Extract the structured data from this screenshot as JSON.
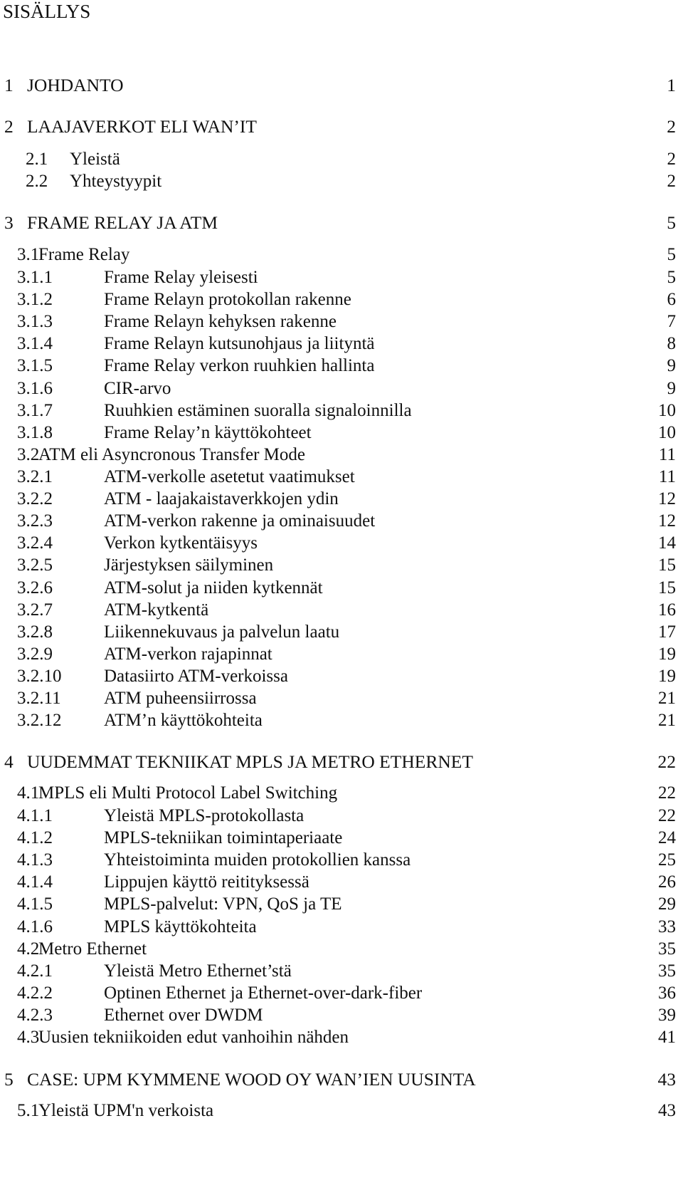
{
  "title": "SISÄLLYS",
  "entries": [
    {
      "num": "1",
      "text": "JOHDANTO",
      "page": "1",
      "level": 1
    },
    {
      "num": "2",
      "text": "LAAJAVERKOT ELI WAN’IT",
      "page": "2",
      "level": 1
    },
    {
      "num": "2.1",
      "text": "Yleistä",
      "page": "2",
      "level": 2
    },
    {
      "num": "2.2",
      "text": "Yhteystyypit",
      "page": "2",
      "level": 2
    },
    {
      "num": "3",
      "text": "FRAME RELAY JA ATM",
      "page": "5",
      "level": 1
    },
    {
      "num": "3.1",
      "text": "Frame Relay",
      "page": "5",
      "level": 2
    },
    {
      "num": "3.1.1",
      "text": "Frame Relay yleisesti",
      "page": "5",
      "level": 3
    },
    {
      "num": "3.1.2",
      "text": "Frame Relayn protokollan rakenne",
      "page": "6",
      "level": 3
    },
    {
      "num": "3.1.3",
      "text": "Frame Relayn kehyksen rakenne",
      "page": "7",
      "level": 3
    },
    {
      "num": "3.1.4",
      "text": "Frame Relayn kutsunohjaus ja liityntä",
      "page": "8",
      "level": 3
    },
    {
      "num": "3.1.5",
      "text": "Frame Relay verkon ruuhkien hallinta",
      "page": "9",
      "level": 3
    },
    {
      "num": "3.1.6",
      "text": "CIR-arvo",
      "page": "9",
      "level": 3
    },
    {
      "num": "3.1.7",
      "text": "Ruuhkien estäminen suoralla signaloinnilla",
      "page": "10",
      "level": 3
    },
    {
      "num": "3.1.8",
      "text": "Frame Relay’n käyttökohteet",
      "page": "10",
      "level": 3
    },
    {
      "num": "3.2",
      "text": "ATM eli Asyncronous Transfer Mode",
      "page": "11",
      "level": 2
    },
    {
      "num": "3.2.1",
      "text": "ATM-verkolle asetetut vaatimukset",
      "page": "11",
      "level": 3
    },
    {
      "num": "3.2.2",
      "text": "ATM - laajakaistaverkkojen ydin",
      "page": "12",
      "level": 3
    },
    {
      "num": "3.2.3",
      "text": "ATM-verkon rakenne ja ominaisuudet",
      "page": "12",
      "level": 3
    },
    {
      "num": "3.2.4",
      "text": "Verkon kytkentäisyys",
      "page": "14",
      "level": 3
    },
    {
      "num": "3.2.5",
      "text": "Järjestyksen säilyminen",
      "page": "15",
      "level": 3
    },
    {
      "num": "3.2.6",
      "text": "ATM-solut ja niiden kytkennät",
      "page": "15",
      "level": 3
    },
    {
      "num": "3.2.7",
      "text": "ATM-kytkentä",
      "page": "16",
      "level": 3
    },
    {
      "num": "3.2.8",
      "text": "Liikennekuvaus ja palvelun laatu",
      "page": "17",
      "level": 3
    },
    {
      "num": "3.2.9",
      "text": "ATM-verkon rajapinnat",
      "page": "19",
      "level": 3
    },
    {
      "num": "3.2.10",
      "text": "Datasiirto ATM-verkoissa",
      "page": "19",
      "level": 3
    },
    {
      "num": "3.2.11",
      "text": "ATM puheensiirrossa",
      "page": "21",
      "level": 3
    },
    {
      "num": "3.2.12",
      "text": "ATM’n käyttökohteita",
      "page": "21",
      "level": 3
    },
    {
      "num": "4",
      "text": "UUDEMMAT TEKNIIKAT MPLS JA METRO ETHERNET",
      "page": "22",
      "level": 1
    },
    {
      "num": "4.1",
      "text": "MPLS eli Multi Protocol Label Switching",
      "page": "22",
      "level": 2
    },
    {
      "num": "4.1.1",
      "text": "Yleistä MPLS-protokollasta",
      "page": "22",
      "level": 3
    },
    {
      "num": "4.1.2",
      "text": "MPLS-tekniikan toimintaperiaate",
      "page": "24",
      "level": 3
    },
    {
      "num": "4.1.3",
      "text": "Yhteistoiminta muiden protokollien kanssa",
      "page": "25",
      "level": 3
    },
    {
      "num": "4.1.4",
      "text": "Lippujen käyttö reitityksessä",
      "page": "26",
      "level": 3
    },
    {
      "num": "4.1.5",
      "text": "MPLS-palvelut: VPN, QoS ja TE",
      "page": "29",
      "level": 3
    },
    {
      "num": "4.1.6",
      "text": "MPLS käyttökohteita",
      "page": "33",
      "level": 3
    },
    {
      "num": "4.2",
      "text": "Metro Ethernet",
      "page": "35",
      "level": 2
    },
    {
      "num": "4.2.1",
      "text": "Yleistä Metro Ethernet’stä",
      "page": "35",
      "level": 3
    },
    {
      "num": "4.2.2",
      "text": "Optinen Ethernet  ja Ethernet-over-dark-fiber",
      "page": "36",
      "level": 3
    },
    {
      "num": "4.2.3",
      "text": "Ethernet over DWDM",
      "page": "39",
      "level": 3
    },
    {
      "num": "4.3",
      "text": "Uusien tekniikoiden edut vanhoihin nähden",
      "page": "41",
      "level": 2
    },
    {
      "num": "5",
      "text": "CASE: UPM KYMMENE WOOD OY WAN’IEN UUSINTA",
      "page": "43",
      "level": 1
    },
    {
      "num": "5.1",
      "text": "Yleistä UPM'n verkoista",
      "page": "43",
      "level": 2
    }
  ]
}
